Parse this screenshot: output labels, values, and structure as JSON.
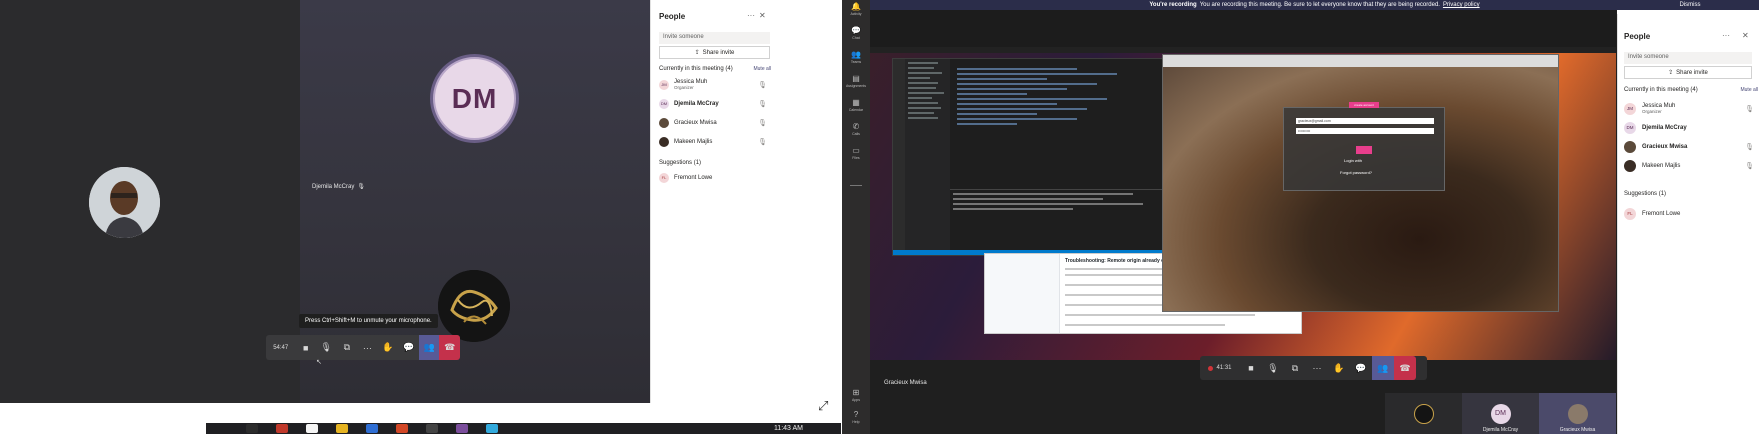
{
  "left_window": {
    "participant_name_tag": "Djemila McCray",
    "dm_initials": "DM",
    "tooltip": "Press Ctrl+Shift+M to unmute your microphone.",
    "call_timer": "54:47",
    "people_panel": {
      "title": "People",
      "invite_placeholder": "Invite someone",
      "share_invite": "Share invite",
      "current_section": "Currently in this meeting (4)",
      "mute_all": "Mute all",
      "participants": [
        {
          "initials": "JM",
          "name": "Jessica Muh",
          "role": "Organizer",
          "bold": false
        },
        {
          "initials": "DM",
          "name": "Djemila McCray",
          "role": "",
          "bold": true
        },
        {
          "initials": "",
          "name": "Gracieux Mwisa",
          "role": "",
          "bold": false
        },
        {
          "initials": "",
          "name": "Makeen Majlis",
          "role": "",
          "bold": false
        }
      ],
      "suggestions_section": "Suggestions (1)",
      "suggestions": [
        {
          "initials": "FL",
          "name": "Fremont Lowe"
        }
      ]
    },
    "taskbar_clock": "11:43 AM"
  },
  "right_window": {
    "recording_banner": {
      "bold": "You're recording",
      "text": "You are recording this meeting. Be sure to let everyone know that they are being recorded.",
      "link": "Privacy policy"
    },
    "dismiss": "Dismiss",
    "rail": [
      {
        "icon": "bell-icon",
        "label": "Activity"
      },
      {
        "icon": "chat-icon",
        "label": "Chat"
      },
      {
        "icon": "teams-icon",
        "label": "Teams"
      },
      {
        "icon": "assignments-icon",
        "label": "Assignments"
      },
      {
        "icon": "calendar-icon",
        "label": "Calendar"
      },
      {
        "icon": "calls-icon",
        "label": "Calls"
      },
      {
        "icon": "files-icon",
        "label": "Files"
      }
    ],
    "rail_bottom": [
      {
        "icon": "apps-icon",
        "label": "Apps"
      },
      {
        "icon": "help-icon",
        "label": "Help"
      }
    ],
    "shared_screen": {
      "login_button_top": "create account",
      "email_value": "gracieux@gmail.com",
      "password_value": "••••••••••",
      "login_label": "Login with",
      "forgot": "Forgot password?",
      "gh_title": "Troubleshooting: Remote origin already exists"
    },
    "call_timer": "41:31",
    "presenter_name": "Gracieux Mwisa",
    "thumbnails": [
      {
        "name": "",
        "initials": ""
      },
      {
        "name": "Djemila McCray",
        "initials": "DM"
      },
      {
        "name": "Gracieux Mwisa",
        "initials": ""
      }
    ],
    "people_panel": {
      "title": "People",
      "invite_placeholder": "Invite someone",
      "share_invite": "Share invite",
      "current_section": "Currently in this meeting (4)",
      "mute_all": "Mute all",
      "participants": [
        {
          "initials": "JM",
          "name": "Jessica Muh",
          "role": "Organizer",
          "bold": false
        },
        {
          "initials": "DM",
          "name": "Djemila McCray",
          "role": "",
          "bold": true
        },
        {
          "initials": "",
          "name": "Gracieux Mwisa",
          "role": "",
          "bold": true
        },
        {
          "initials": "",
          "name": "Makeen Majlis",
          "role": "",
          "bold": false
        }
      ],
      "suggestions_section": "Suggestions (1)",
      "suggestions": [
        {
          "initials": "FL",
          "name": "Fremont Lowe"
        }
      ]
    }
  },
  "colors": {
    "teams_purple": "#585a96",
    "hangup_red": "#c4314b",
    "accent_pink": "#e83e8c"
  }
}
